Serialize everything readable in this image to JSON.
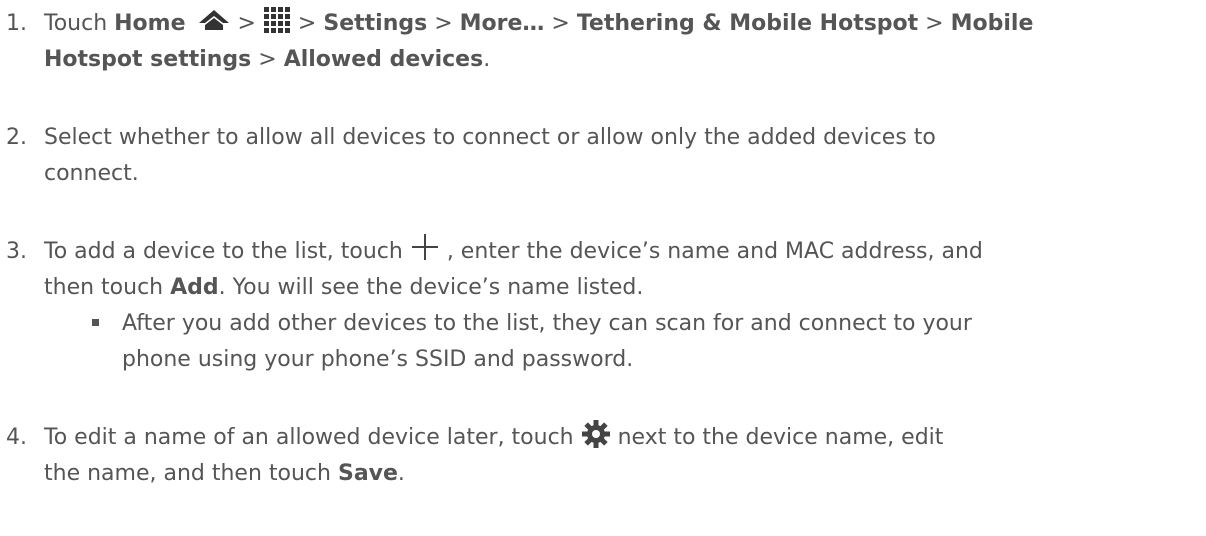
{
  "steps": [
    {
      "number": "1.",
      "line1_a": "Touch ",
      "home": "Home",
      "sep1": " > ",
      "sep2": " > ",
      "settings": "Settings",
      "sep3": " > ",
      "more": "More…",
      "sep4": " > ",
      "tethering": "Tethering & Mobile Hotspot",
      "sep5": " > ",
      "mobile": "Mobile",
      "line2_bold": "Hotspot settings",
      "sep6": " > ",
      "allowed": "Allowed devices",
      "end": "."
    },
    {
      "number": "2.",
      "line1": "Select whether to allow all devices to connect or allow only the added devices to",
      "line2": "connect."
    },
    {
      "number": "3.",
      "line1_a": "To add a device to the list, touch ",
      "line1_b": " , enter the device’s name and MAC address, and",
      "line2_a": "then touch ",
      "add": "Add",
      "line2_b": ". You will see the device’s name listed."
    },
    {
      "number": "4.",
      "line1_a": "To edit a name of an allowed device later, touch ",
      "line1_b": " next to the device name, edit",
      "line2_a": "the name, and then touch ",
      "save": "Save",
      "line2_b": "."
    }
  ],
  "sub_bullet": {
    "line1": "After you add other devices to the list, they can scan for and connect to your",
    "line2": "phone using your phone’s SSID and password."
  },
  "icons": {
    "home": "home-icon",
    "apps": "apps-grid-icon",
    "add": "plus-icon",
    "settings": "gear-icon"
  },
  "colors": {
    "text": "#555555",
    "icon": "#333333"
  }
}
